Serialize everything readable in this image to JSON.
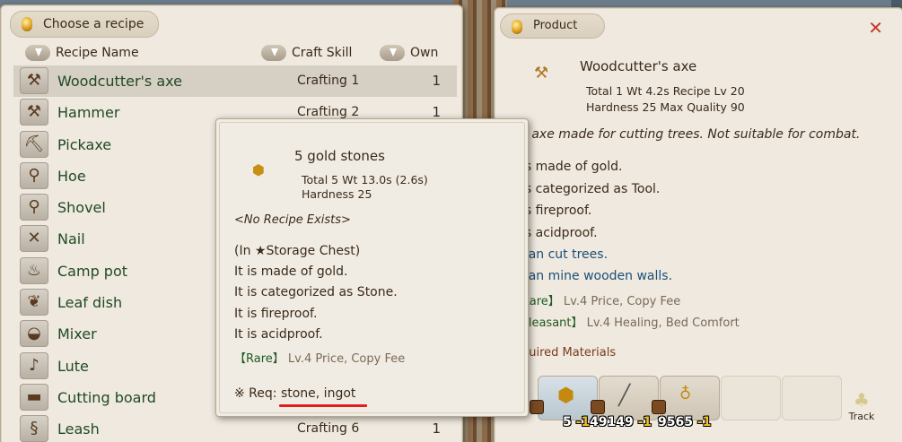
{
  "recipe_panel": {
    "title": "Choose a recipe",
    "headers": {
      "name": "Recipe Name",
      "skill": "Craft Skill",
      "own": "Own"
    },
    "recipes": [
      {
        "name": "Woodcutter's axe",
        "icon": "axe-icon",
        "glyph": "⚒",
        "skill": "Crafting 1",
        "own": "1"
      },
      {
        "name": "Hammer",
        "icon": "hammer-icon",
        "glyph": "⚒",
        "skill": "Crafting 2",
        "own": "1"
      },
      {
        "name": "Pickaxe",
        "icon": "pickaxe-icon",
        "glyph": "⛏",
        "skill": "",
        "own": ""
      },
      {
        "name": "Hoe",
        "icon": "hoe-icon",
        "glyph": "⚲",
        "skill": "",
        "own": ""
      },
      {
        "name": "Shovel",
        "icon": "shovel-icon",
        "glyph": "⚲",
        "skill": "",
        "own": ""
      },
      {
        "name": "Nail",
        "icon": "nail-icon",
        "glyph": "✕",
        "skill": "",
        "own": ""
      },
      {
        "name": "Camp pot",
        "icon": "camp-pot-icon",
        "glyph": "♨",
        "skill": "",
        "own": ""
      },
      {
        "name": "Leaf dish",
        "icon": "leaf-dish-icon",
        "glyph": "❦",
        "skill": "",
        "own": ""
      },
      {
        "name": "Mixer",
        "icon": "mixer-icon",
        "glyph": "◒",
        "skill": "",
        "own": ""
      },
      {
        "name": "Lute",
        "icon": "lute-icon",
        "glyph": "♪",
        "skill": "",
        "own": ""
      },
      {
        "name": "Cutting board",
        "icon": "cutting-board-icon",
        "glyph": "▬",
        "skill": "",
        "own": ""
      },
      {
        "name": "Leash",
        "icon": "leash-icon",
        "glyph": "§",
        "skill": "Crafting 6",
        "own": "1"
      }
    ]
  },
  "product_panel": {
    "title": "Product",
    "close": "✕",
    "name": "Woodcutter's axe",
    "stats1": "Total 1  Wt 4.2s  Recipe Lv 20",
    "stats2": "Hardness 25  Max Quality 90",
    "description": "n axe made for cutting trees. Not suitable for combat.",
    "lines": [
      "is made of gold.",
      "is categorized as Tool.",
      "is fireproof.",
      "is acidproof.",
      "can cut trees.",
      "can mine wooden walls."
    ],
    "trait1_tag": "Rare】",
    "trait1_text": " Lv.4 Price, Copy Fee",
    "trait2_tag": "Pleasant】",
    "trait2_text": " Lv.4 Healing, Bed Comfort",
    "req_title": "quired Materials",
    "materials": [
      {
        "count": "5",
        "delta": "-1",
        "icon": "gold-stone-icon"
      },
      {
        "count": "49149",
        "delta": "-1",
        "icon": "stick-icon"
      },
      {
        "count": "9565",
        "delta": "-1",
        "icon": "flask-icon"
      }
    ],
    "track_label": "Track"
  },
  "tooltip": {
    "name": "5 gold stones",
    "stats1": "Total 5  Wt 13.0s (2.6s)",
    "stats2": "Hardness 25",
    "no_recipe": "<No Recipe Exists>",
    "location": "(In ★Storage Chest)",
    "made_of": "It is made of gold.",
    "category": "It is categorized as Stone.",
    "fireproof": "It is fireproof.",
    "acidproof": "It is acidproof.",
    "trait_tag": "【Rare】",
    "trait_text": " Lv.4 Price, Copy Fee",
    "req": "※ Req: stone, ingot"
  }
}
